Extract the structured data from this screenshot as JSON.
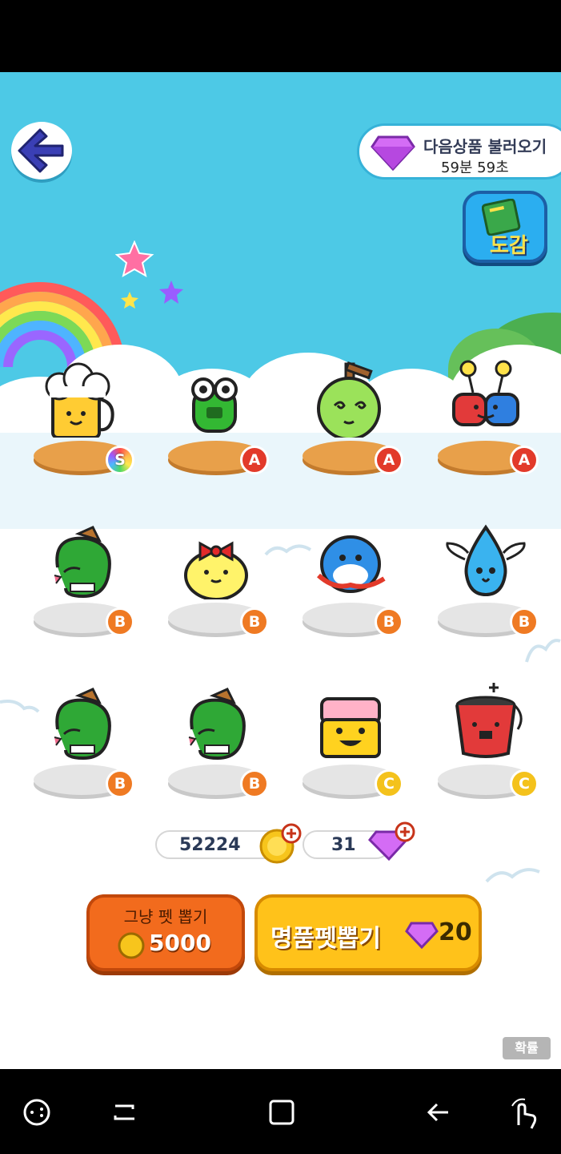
{
  "header": {
    "next_item_title": "다음상품 불러오기",
    "next_item_timer": "59분 59초",
    "dex_label": "도감"
  },
  "pets": [
    {
      "name": "beer",
      "grade": "S"
    },
    {
      "name": "frog",
      "grade": "A"
    },
    {
      "name": "melon",
      "grade": "A"
    },
    {
      "name": "magnet",
      "grade": "A"
    },
    {
      "name": "snake",
      "grade": "B"
    },
    {
      "name": "chick-ribbon",
      "grade": "B"
    },
    {
      "name": "blue-bird",
      "grade": "B"
    },
    {
      "name": "water-drop-angel",
      "grade": "B"
    },
    {
      "name": "snake",
      "grade": "B"
    },
    {
      "name": "snake",
      "grade": "B"
    },
    {
      "name": "eraser",
      "grade": "C"
    },
    {
      "name": "bucket",
      "grade": "C"
    }
  ],
  "wallet": {
    "coins": "52224",
    "gems": "31"
  },
  "actions": {
    "normal_draw_label": "그냥 펫 뽑기",
    "normal_draw_cost": "5000",
    "premium_draw_label": "명품펫뽑기",
    "premium_draw_cost": "20"
  },
  "odds_label": "확률",
  "colors": {
    "sky": "#4dc9e6",
    "grade_S": "rainbow",
    "grade_A": "#e23a2a",
    "grade_B": "#ef7a23",
    "grade_C": "#f4c21c"
  }
}
